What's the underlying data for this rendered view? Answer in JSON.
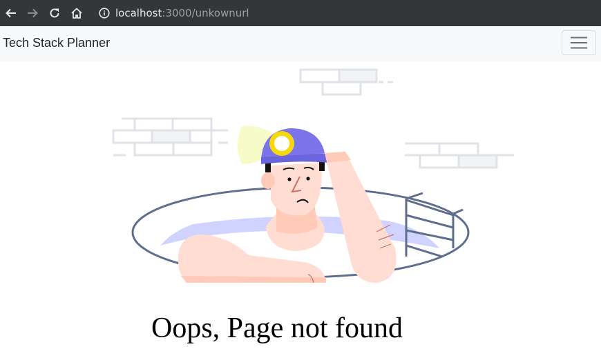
{
  "browser": {
    "url_host": "localhost",
    "url_path": ":3000/unkownurl",
    "icons": [
      "back-arrow-icon",
      "forward-arrow-icon",
      "reload-icon",
      "home-icon",
      "info-icon"
    ]
  },
  "navbar": {
    "brand": "Tech Stack Planner",
    "menu_icon": "hamburger-icon"
  },
  "main": {
    "heading": "Oops, Page not found",
    "illustration": "worker-in-manhole-illustration"
  },
  "colors": {
    "browser_bar": "#35363a",
    "navbar_bg": "#f8f9fa",
    "helmet": "#7b74ea",
    "skin": "#ffddd3",
    "manhole_outline": "#5e6e8c",
    "brick_outline": "#dfe3e8"
  }
}
